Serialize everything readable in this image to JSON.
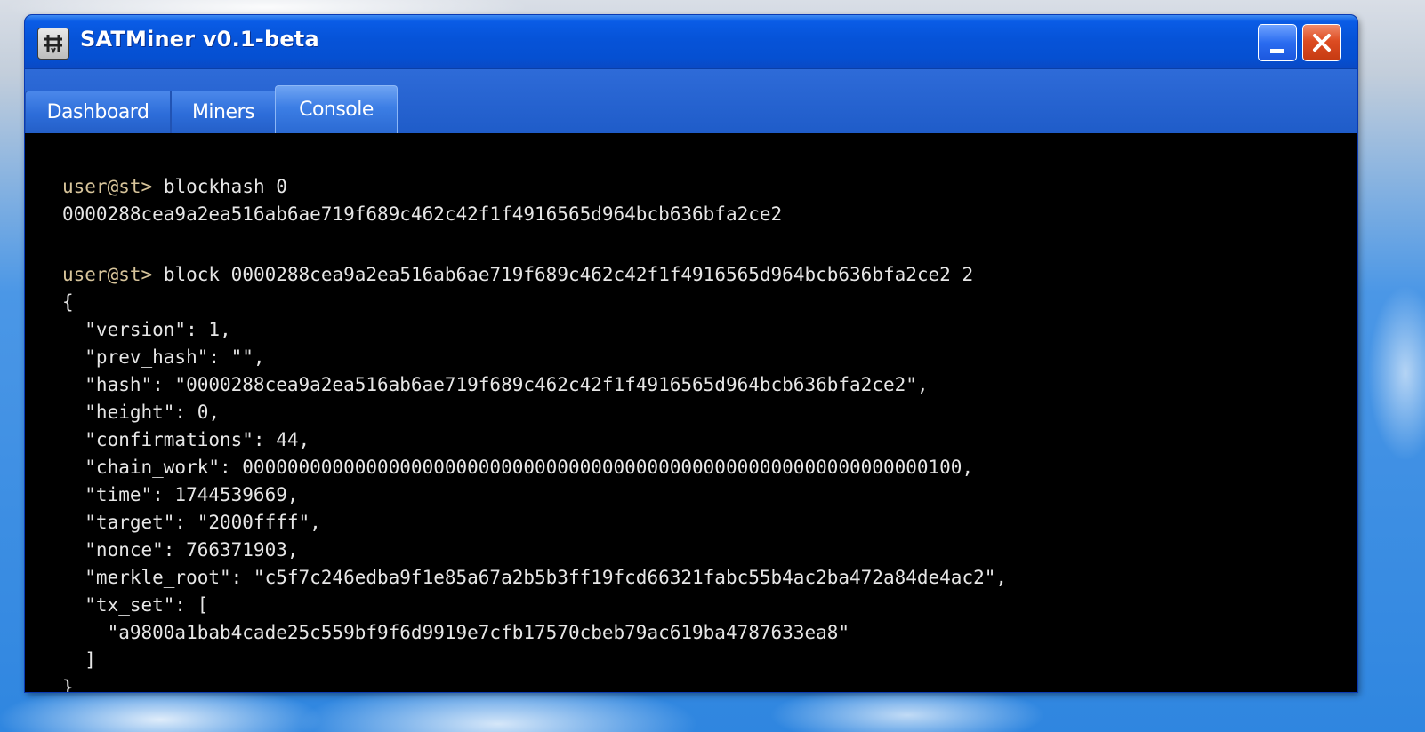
{
  "window": {
    "title": "SATMiner v0.1-beta",
    "colors": {
      "titlebar": "#0653d8",
      "close_button": "#dd4c22",
      "console_bg": "#000000",
      "prompt": "#d7c49a",
      "text": "#e6e6e6"
    }
  },
  "icons": {
    "app": "app-logo-icon",
    "minimize": "minimize-icon",
    "close": "close-icon"
  },
  "tabs": [
    {
      "label": "Dashboard",
      "active": false
    },
    {
      "label": "Miners",
      "active": false
    },
    {
      "label": "Console",
      "active": true
    }
  ],
  "console": {
    "prompt": "user@st>",
    "entries": [
      {
        "command": "blockhash 0",
        "output": [
          "0000288cea9a2ea516ab6ae719f689c462c42f1f4916565d964bcb636bfa2ce2"
        ]
      },
      {
        "command": "block 0000288cea9a2ea516ab6ae719f689c462c42f1f4916565d964bcb636bfa2ce2 2",
        "output": [
          "{",
          "  \"version\": 1,",
          "  \"prev_hash\": \"\",",
          "  \"hash\": \"0000288cea9a2ea516ab6ae719f689c462c42f1f4916565d964bcb636bfa2ce2\",",
          "  \"height\": 0,",
          "  \"confirmations\": 44,",
          "  \"chain_work\": 0000000000000000000000000000000000000000000000000000000000000100,",
          "  \"time\": 1744539669,",
          "  \"target\": \"2000ffff\",",
          "  \"nonce\": 766371903,",
          "  \"merkle_root\": \"c5f7c246edba9f1e85a67a2b5b3ff19fcd66321fabc55b4ac2ba472a84de4ac2\",",
          "  \"tx_set\": [",
          "    \"a9800a1bab4cade25c559bf9f6d9919e7cfb17570cbeb79ac619ba4787633ea8\"",
          "  ]",
          "}"
        ]
      }
    ]
  }
}
